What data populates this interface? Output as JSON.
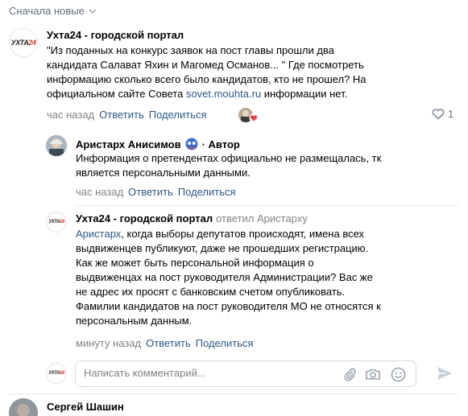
{
  "sort": {
    "label": "Сначала новые"
  },
  "post": {
    "author": "Ухта24 - городской портал",
    "logo": {
      "main": "УХТА",
      "accent": "24"
    },
    "text_line1": "\"Из поданных на конкурс заявок на пост главы прошли два",
    "text_line2": "кандидата Салават Яхин и Магомед Османов... \" Где посмотреть",
    "text_line3": "информацию сколько всего было кандидатов, кто не прошел? На",
    "text_line4_pre": "официальном сайте Совета ",
    "text_link": "sovet.mouhta.ru",
    "text_line4_post": " информации нет.",
    "time": "час назад",
    "reply": "Ответить",
    "share": "Поделиться",
    "likes": "1"
  },
  "reply1": {
    "author": "Аристарх Анисимов",
    "role": "· Автор",
    "text_line1": "Информация о претендентах официально не размещалась, тк",
    "text_line2": "является персональными данными.",
    "time": "час назад",
    "reply": "Ответить",
    "share": "Поделиться"
  },
  "reply2": {
    "author": "Ухта24 - городской портал",
    "replied": "ответил Аристарху",
    "mention": "Аристарх",
    "text_line1_rest": ", когда выборы депутатов происходят, имена всех",
    "text_line2": "выдвиженцев публикуют, даже не прошедших регистрацию.",
    "text_line3": "Как же может быть персональной информация о",
    "text_line4": "выдвиженцах на пост руководителя Администрации? Вас же",
    "text_line5": "не адрес их просят с банковским счетом опубликовать.",
    "text_line6": "Фамилии кандидатов на пост руководителя МО не относятся к",
    "text_line7": "персональным данным.",
    "time": "минуту назад",
    "reply": "Ответить",
    "share": "Поделиться"
  },
  "composer": {
    "placeholder": "Написать комментарий..."
  },
  "next_comment": {
    "author": "Сергей Шашин"
  },
  "colors": {
    "link": "#2a5885",
    "meta": "#828282",
    "like": "#e64646"
  }
}
